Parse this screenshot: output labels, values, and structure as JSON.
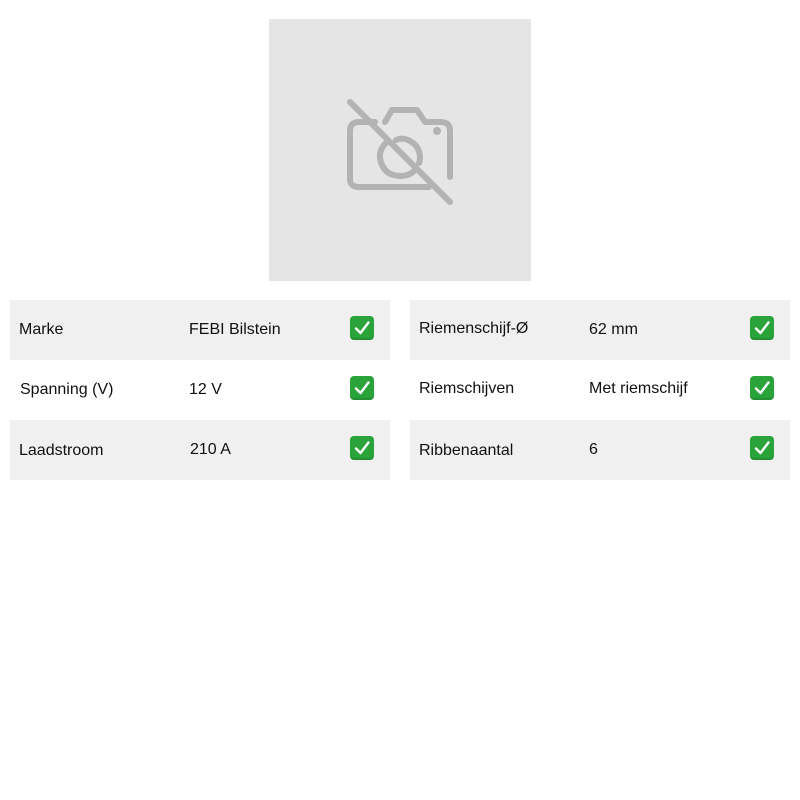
{
  "image": {
    "icon": "no-camera-icon",
    "background": "#e5e5e5",
    "icon_color": "#b3b3b3"
  },
  "specs_left": [
    {
      "label": "Marke",
      "value": "FEBI Bilstein",
      "check": "check-icon"
    },
    {
      "label": "Spanning (V)",
      "value": "12 V",
      "check": "check-icon"
    },
    {
      "label": "Laadstroom",
      "value": "210 A",
      "check": "check-icon"
    }
  ],
  "specs_right": [
    {
      "label": "Riemenschijf-Ø",
      "value": "62 mm",
      "check": "check-icon"
    },
    {
      "label": "Riemschijven",
      "value": "Met riemschijf",
      "check": "check-icon"
    },
    {
      "label": "Ribbenaantal",
      "value": "6",
      "check": "check-icon"
    }
  ],
  "colors": {
    "row_shade": "#f0f0f0",
    "check_green": "#2aa33a"
  }
}
